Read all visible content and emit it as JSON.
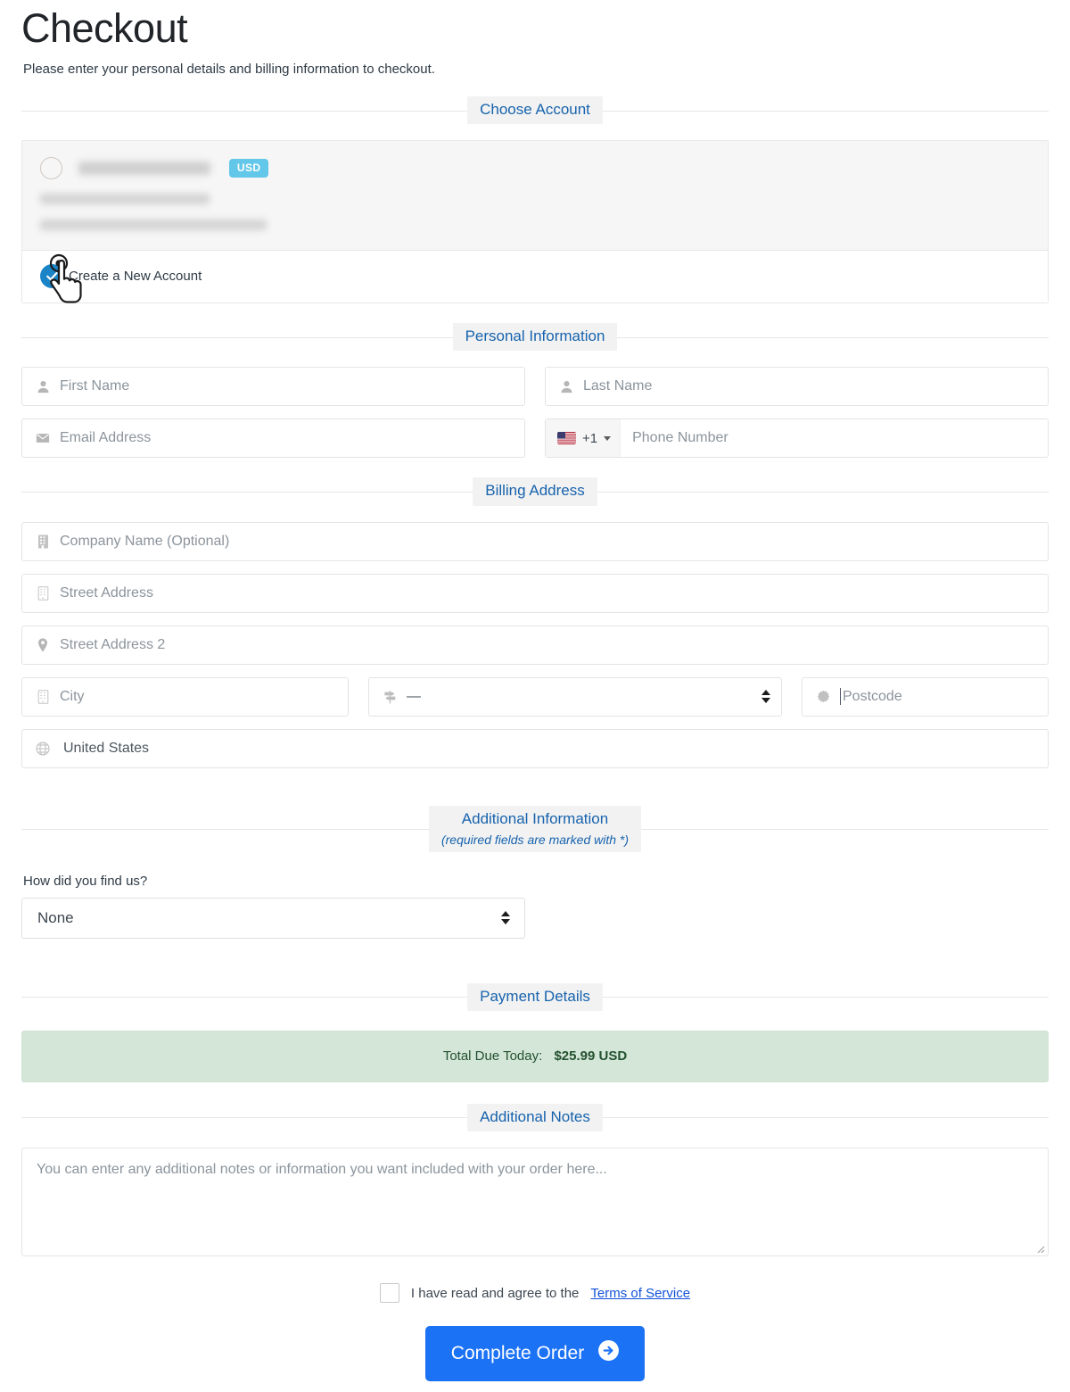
{
  "header": {
    "title": "Checkout",
    "subtitle": "Please enter your personal details and billing information to checkout."
  },
  "sections": {
    "choose_account": "Choose Account",
    "personal_information": "Personal Information",
    "billing_address": "Billing Address",
    "additional_information": "Additional Information",
    "additional_information_note": "(required fields are marked with *)",
    "payment_details": "Payment Details",
    "additional_notes": "Additional Notes"
  },
  "accounts": {
    "existing": {
      "currency_badge": "USD",
      "selected": false
    },
    "new_account": {
      "label": "Create a New Account",
      "selected": true
    }
  },
  "personal": {
    "first_name": {
      "placeholder": "First Name",
      "value": "",
      "icon": "user-icon"
    },
    "last_name": {
      "placeholder": "Last Name",
      "value": "",
      "icon": "user-icon"
    },
    "email": {
      "placeholder": "Email Address",
      "value": "",
      "icon": "envelope-icon"
    },
    "phone": {
      "placeholder": "Phone Number",
      "value": "",
      "dial_code": "+1",
      "flag": "us-flag-icon"
    }
  },
  "billing": {
    "company": {
      "placeholder": "Company Name (Optional)",
      "value": "",
      "icon": "building-icon"
    },
    "street1": {
      "placeholder": "Street Address",
      "value": "",
      "icon": "building-icon"
    },
    "street2": {
      "placeholder": "Street Address 2",
      "value": "",
      "icon": "map-pin-icon"
    },
    "city": {
      "placeholder": "City",
      "value": "",
      "icon": "building-icon"
    },
    "state": {
      "value": "—",
      "icon": "signpost-icon"
    },
    "postcode": {
      "placeholder": "Postcode",
      "value": "",
      "icon": "starburst-icon"
    },
    "country": {
      "value": "United States",
      "icon": "globe-icon"
    }
  },
  "additional": {
    "how_did_you_find_us_label": "How did you find us?",
    "how_did_you_find_us_value": "None"
  },
  "payment": {
    "total_label": "Total Due Today:",
    "total_amount": "$25.99 USD"
  },
  "notes": {
    "placeholder": "You can enter any additional notes or information you want included with your order here..."
  },
  "terms": {
    "text": "I have read and agree to the",
    "link": "Terms of Service",
    "checked": false
  },
  "submit": {
    "label": "Complete Order",
    "icon": "arrow-circle-right-icon"
  },
  "colors": {
    "accent_blue": "#1c72f5",
    "legend_blue": "#1763ad",
    "badge_cyan": "#62c7e8",
    "radio_blue": "#1b84c6",
    "total_green_bg": "#d4e6d8",
    "total_green_text": "#23512f",
    "link_blue": "#1352d8"
  }
}
